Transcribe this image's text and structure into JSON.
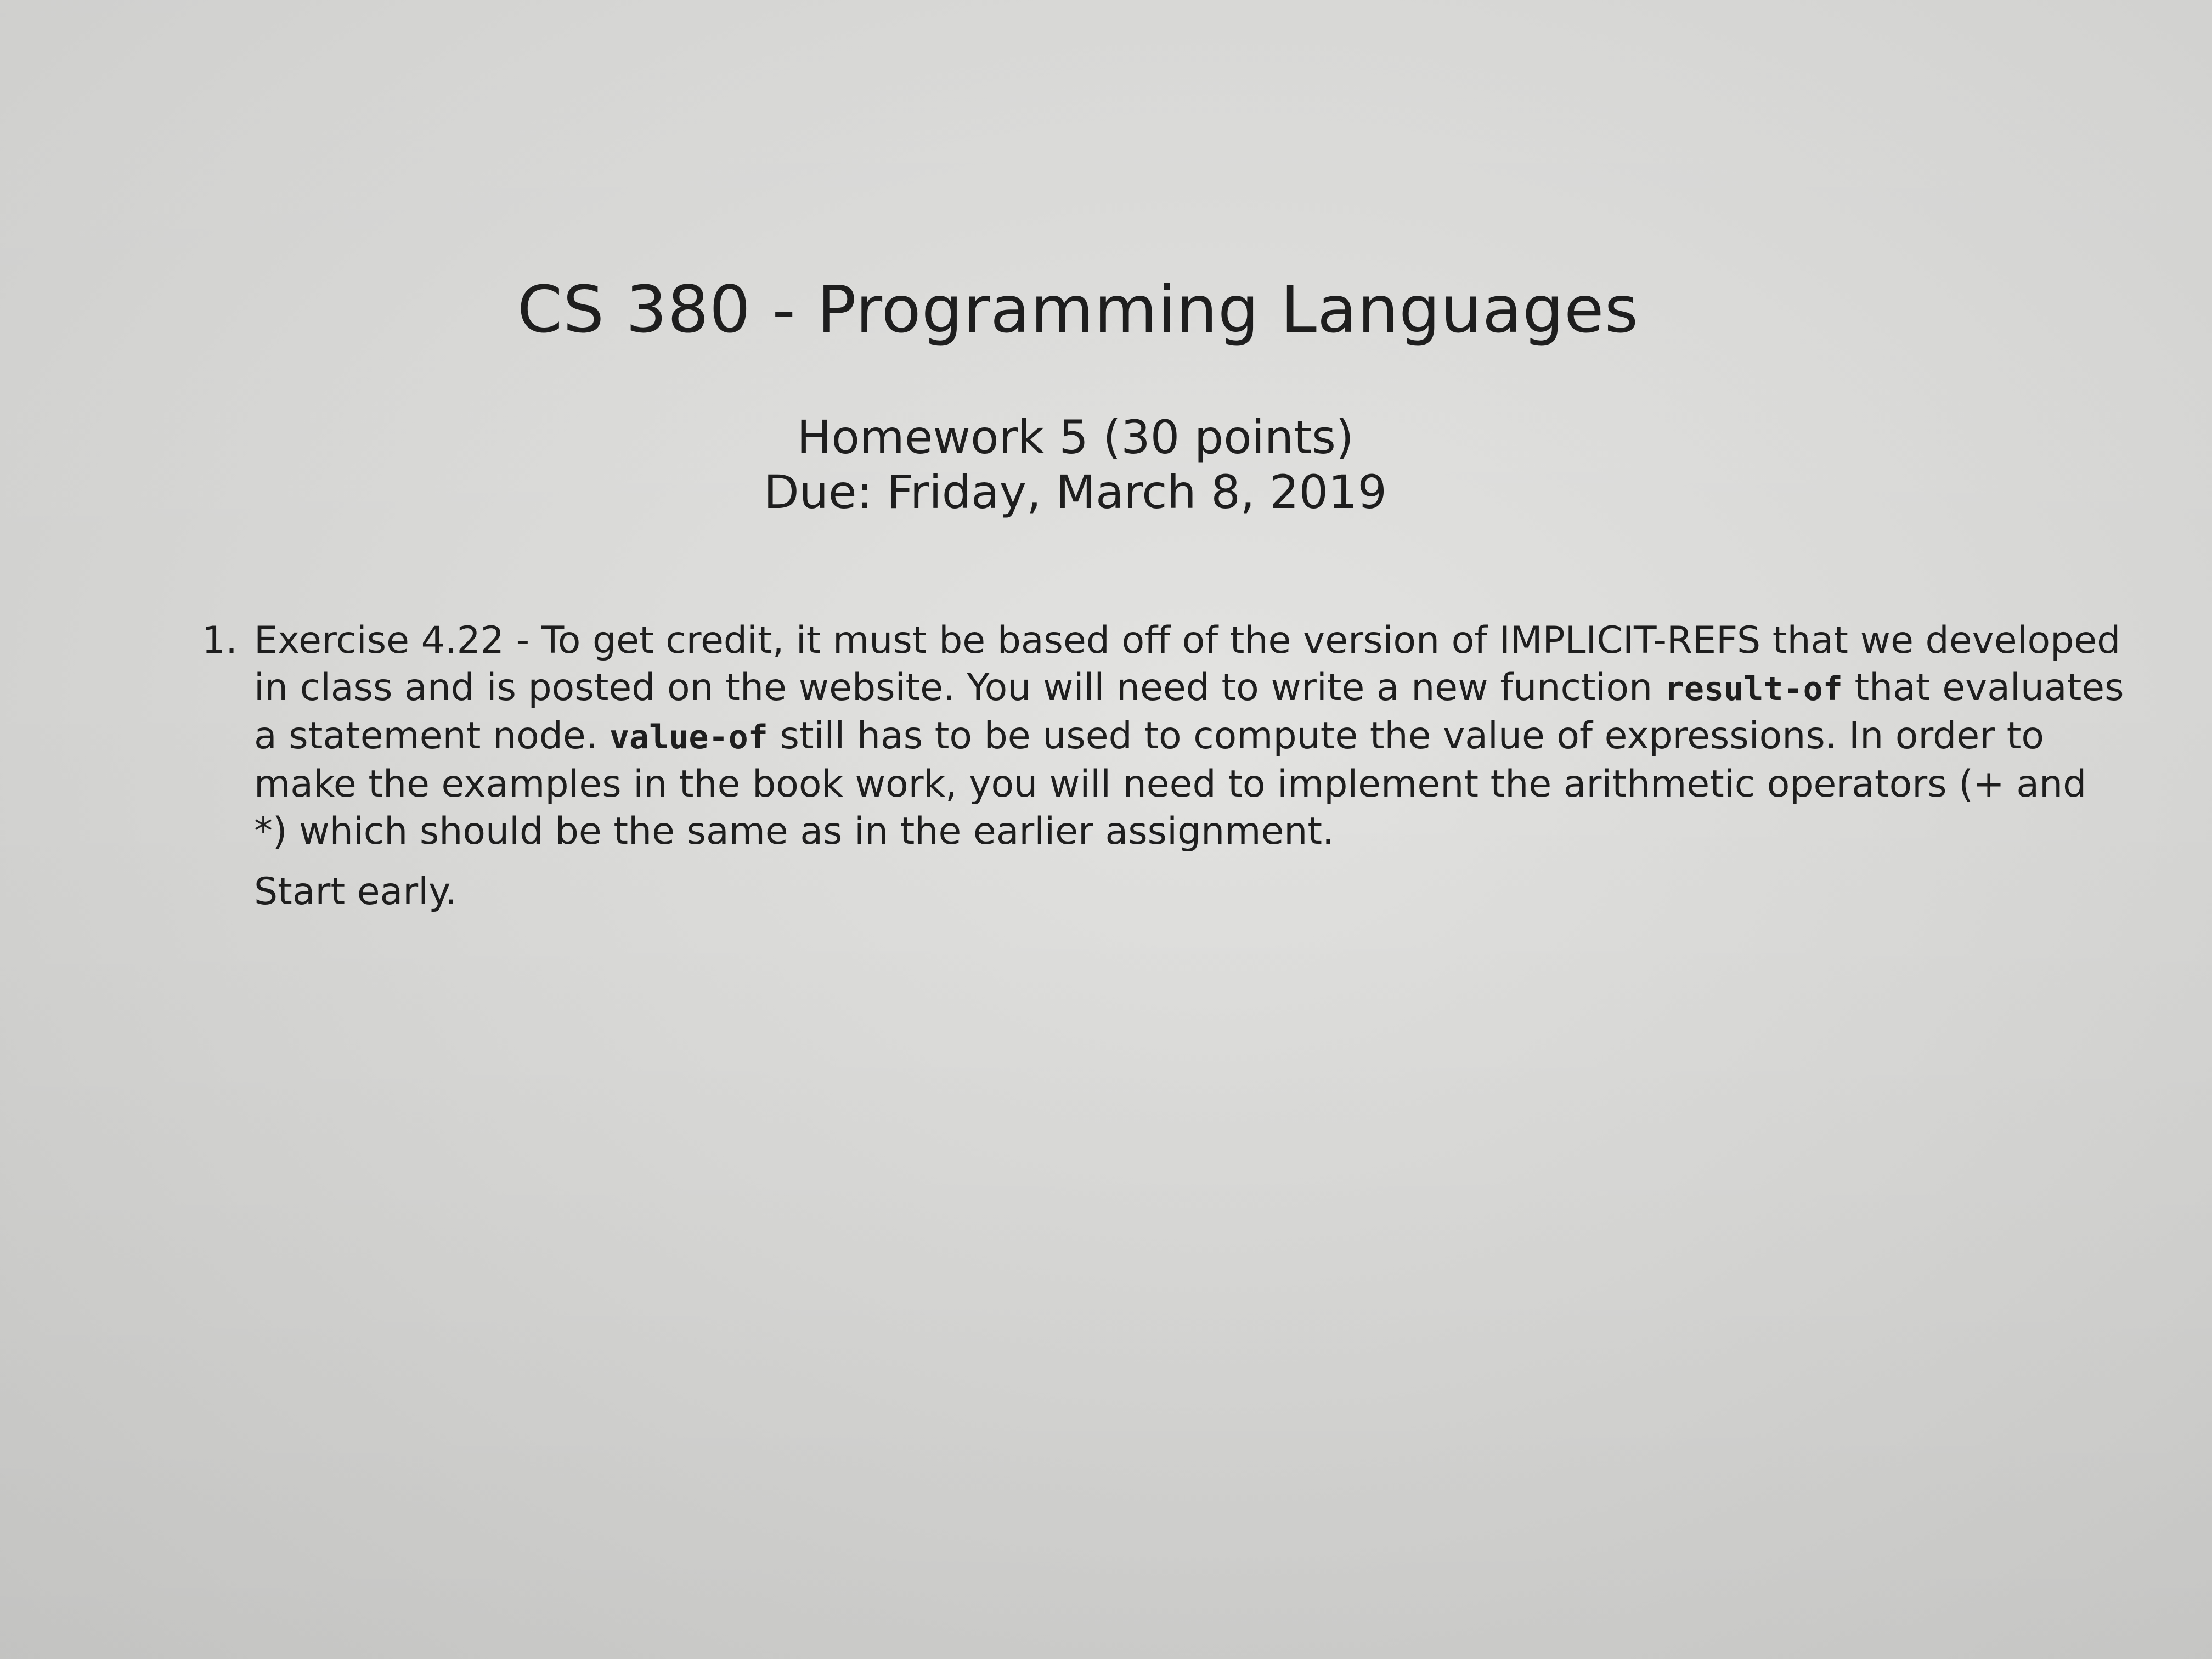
{
  "document": {
    "title": "CS 380 - Programming Languages",
    "homework": "Homework 5 (30 points)",
    "due": "Due: Friday, March 8, 2019",
    "item": {
      "number": "1.",
      "line1": "Exercise 4.22 - To get credit, it must be based off of the version of IMPLICIT-REFS that we developed",
      "line2_before": "in class and is posted on the website. You will need to write a new function ",
      "line2_code": "result-of",
      "line2_after": " that evaluates",
      "line3_before": "a statement node. ",
      "line3_code": "value-of",
      "line3_after": " still has to be used to compute the value of expressions. In order to",
      "line4": "make the examples in the book work, you will need to implement the arithmetic operators (+ and",
      "line5": "*) which should be the same as in the earlier assignment."
    },
    "note": "Start early."
  }
}
